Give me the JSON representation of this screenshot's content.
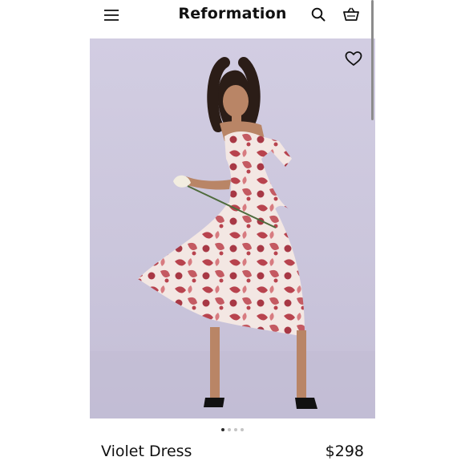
{
  "header": {
    "brand": "Reformation",
    "menu_icon": "hamburger-menu-icon",
    "search_icon": "search-icon",
    "bag_icon": "shopping-bag-icon"
  },
  "product": {
    "name": "Violet Dress",
    "price": "$298",
    "favorite_icon": "heart-outline-icon",
    "image_description_icon": "product-photo",
    "carousel": {
      "total": 4,
      "active": 1
    }
  },
  "colors": {
    "photo_background": "#cbc6dc",
    "dress_red": "#b8434e",
    "text": "#111111"
  }
}
